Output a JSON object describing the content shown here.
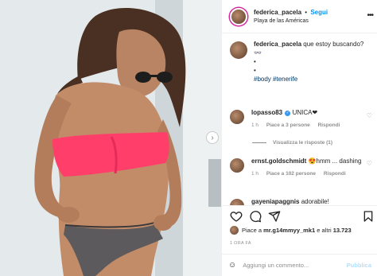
{
  "post_header": {
    "username": "federica_pacela",
    "dot": "•",
    "follow_label": "Segui",
    "location": "Playa de las Américas",
    "more_icon": "more-horizontal-icon"
  },
  "caption": {
    "username": "federica_pacela",
    "text": "que estoy buscando?",
    "emoji_line": "👓",
    "dot1": "•",
    "dot2": "•",
    "hashtags": "#body #tenerife"
  },
  "comments": [
    {
      "username": "lopasso83",
      "verified": true,
      "text": "UNICA❤",
      "time": "1 h",
      "likes": "Piace a 3 persone",
      "reply": "Rispondi"
    },
    {
      "username": "ernst.goldschmidt",
      "verified": false,
      "text": "😍hmm ... dashing",
      "time": "1 h",
      "likes": "Piace a 102 persone",
      "reply": "Rispondi"
    },
    {
      "username": "gayeniapaggnis",
      "verified": false,
      "text": "adorabile!",
      "time": "",
      "likes": "",
      "reply": ""
    }
  ],
  "view_replies": "Visualizza le risposte (1)",
  "likes_line": {
    "prefix": "Piace a",
    "user": "mr.g14mmyy_mk1",
    "middle": "e altri",
    "count": "13.723"
  },
  "time_ago": "1 ORA FA",
  "add_comment": {
    "placeholder": "Aggiungi un commento...",
    "post_label": "Pubblica"
  },
  "colors": {
    "link_blue": "#0095f6",
    "hashtag_blue": "#00376b",
    "bikini_pink": "#ff3f6a",
    "verified_blue": "#3897f0"
  }
}
